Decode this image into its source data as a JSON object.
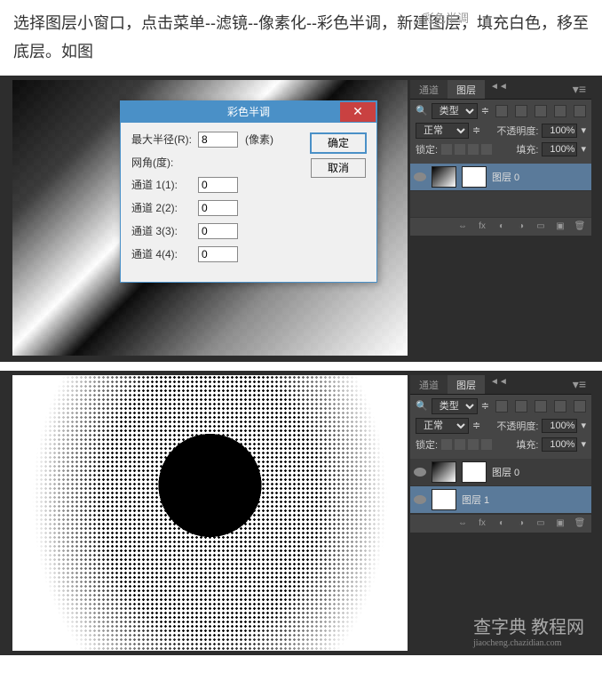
{
  "instruction": "选择图层小窗口，点击菜单--滤镜--像素化--彩色半调，新建图层，填充白色，移至底层。如图",
  "watermark_top": "彩色半调",
  "dialog": {
    "title": "彩色半调",
    "max_radius_label": "最大半径(R):",
    "max_radius_value": "8",
    "unit": "(像素)",
    "angle_label": "网角(度):",
    "ch1_label": "通道 1(1):",
    "ch1_value": "0",
    "ch2_label": "通道 2(2):",
    "ch2_value": "0",
    "ch3_label": "通道 3(3):",
    "ch3_value": "0",
    "ch4_label": "通道 4(4):",
    "ch4_value": "0",
    "ok": "确定",
    "cancel": "取消"
  },
  "panel": {
    "tab_channels": "通道",
    "tab_layers": "图层",
    "filter_label": "类型",
    "blend_mode": "正常",
    "opacity_label": "不透明度:",
    "opacity_value": "100%",
    "lock_label": "锁定:",
    "fill_label": "填充:",
    "fill_value": "100%",
    "layer0_name": "图层 0",
    "layer1_name": "图层 1"
  },
  "watermark": {
    "main": "查字典  教程网",
    "sub": "jiaocheng.chazidian.com"
  }
}
